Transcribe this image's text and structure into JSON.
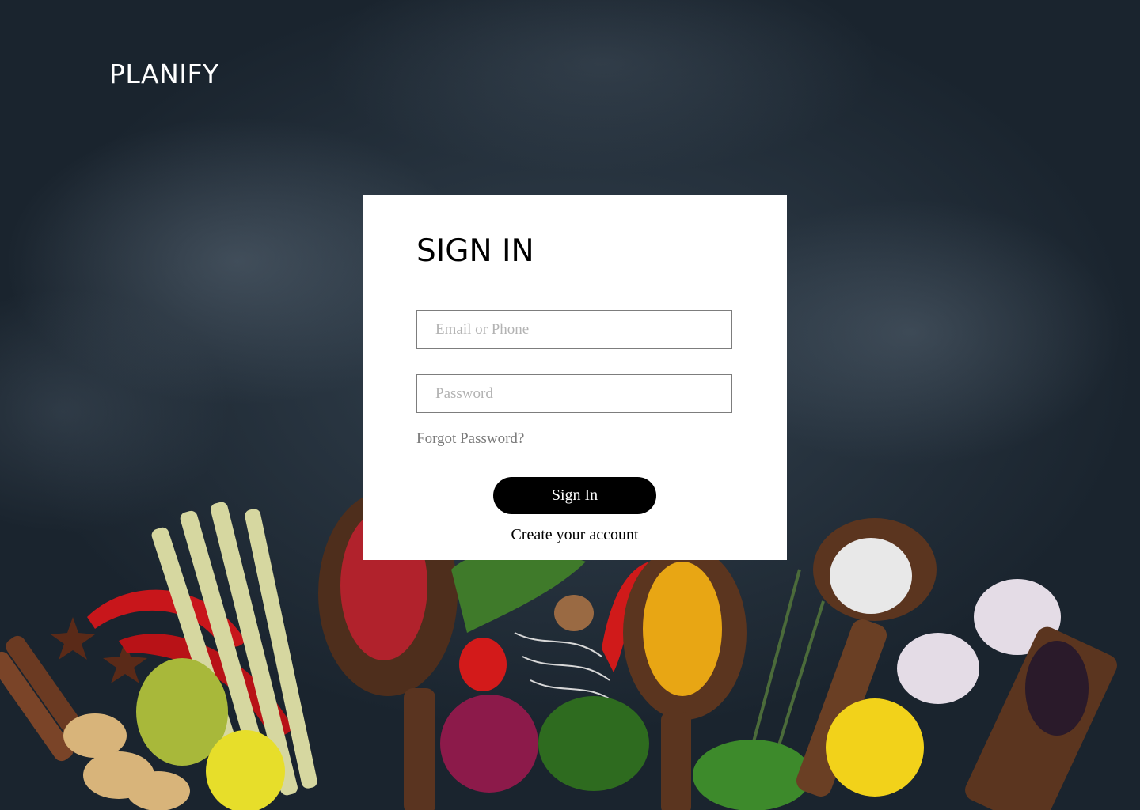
{
  "brand": {
    "name": "PLANIFY"
  },
  "signin": {
    "title": "SIGN IN",
    "email_placeholder": "Email or Phone",
    "password_placeholder": "Password",
    "forgot_label": "Forgot Password?",
    "submit_label": "Sign In",
    "create_label": "Create your account"
  },
  "colors": {
    "background": "#1f2b36",
    "card": "#ffffff",
    "button": "#000000",
    "button_text": "#ffffff",
    "muted_text": "#7a7a7a"
  }
}
